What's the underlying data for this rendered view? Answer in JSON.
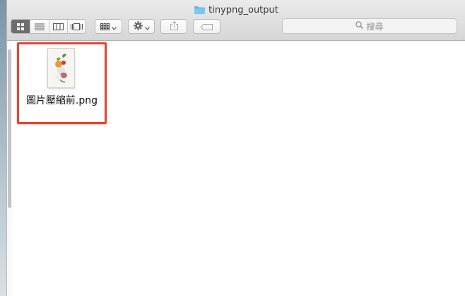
{
  "window": {
    "title": "tinypng_output"
  },
  "toolbar": {
    "view_modes": [
      {
        "name": "icon-view-button",
        "icon": "grid-icon",
        "active": true
      },
      {
        "name": "list-view-button",
        "icon": "list-icon",
        "active": false
      },
      {
        "name": "column-view-button",
        "icon": "columns-icon",
        "active": false
      },
      {
        "name": "coverflow-view-button",
        "icon": "coverflow-icon",
        "active": false
      }
    ],
    "arrange_icon": "arrange-grid-icon",
    "action_icon": "gear-icon",
    "share_icon": "share-icon",
    "tag_icon": "tag-icon"
  },
  "search": {
    "placeholder": "搜尋",
    "icon": "search-icon"
  },
  "files": [
    {
      "name": "圖片壓縮前.png",
      "selected_highlight": true
    }
  ],
  "colors": {
    "highlight": "#e5442f",
    "folder": "#5ab4ee"
  }
}
